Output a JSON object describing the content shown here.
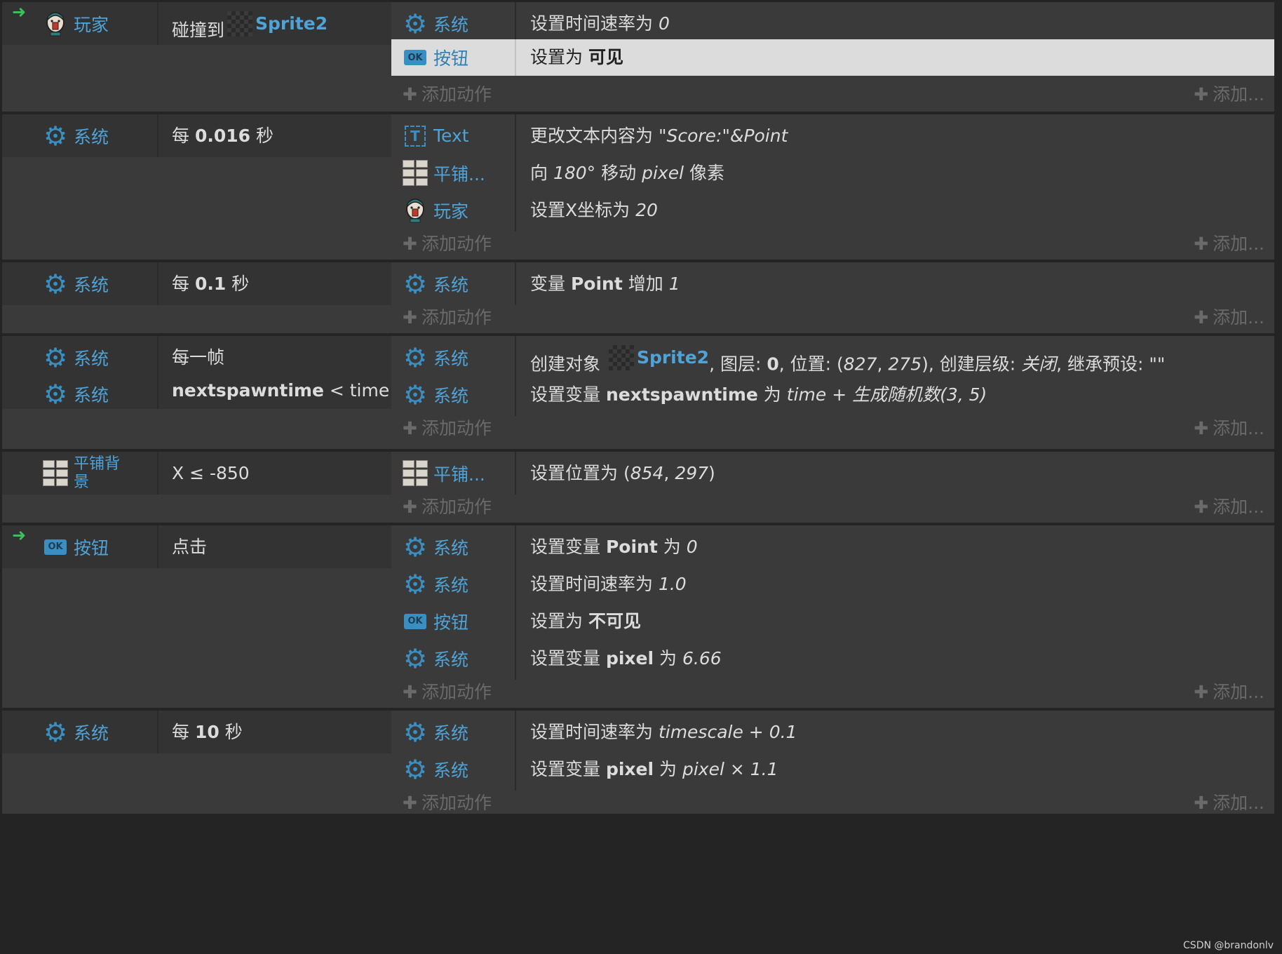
{
  "blocks": [
    {
      "conditions": [
        {
          "trigger": true,
          "icon": "player-icon",
          "object": "玩家",
          "text_prefix": "碰撞到",
          "text_object": "Sprite2"
        }
      ],
      "actions": [
        {
          "icon": "gear-icon",
          "object": "系统",
          "text": "设置时间速率为 ",
          "text_italic": "0"
        },
        {
          "icon": "ok-button-icon",
          "object": "按钮",
          "selected": true,
          "text": "设置为 ",
          "text_bold": "可见"
        }
      ]
    },
    {
      "conditions": [
        {
          "icon": "gear-icon",
          "object": "系统",
          "text": "每 ",
          "text_bold": "0.016",
          "text_after": " 秒"
        }
      ],
      "actions": [
        {
          "icon": "text-object-icon",
          "object": "Text",
          "text": "更改文本内容为 ",
          "text_italic": "\"Score:\"&Point"
        },
        {
          "icon": "tiled-background-icon",
          "object": "平铺...",
          "text": "向 ",
          "text_italic": "180°",
          "text_after": " 移动 ",
          "text_italic2": "pixel",
          "text_after2": " 像素"
        },
        {
          "icon": "player-icon",
          "object": "玩家",
          "text": "设置X坐标为 ",
          "text_italic": "20"
        }
      ]
    },
    {
      "conditions": [
        {
          "icon": "gear-icon",
          "object": "系统",
          "text": "每 ",
          "text_bold": "0.1",
          "text_after": " 秒"
        }
      ],
      "actions": [
        {
          "icon": "gear-icon",
          "object": "系统",
          "text": "变量 ",
          "text_bold": "Point",
          "text_after": " 增加 ",
          "text_italic": "1"
        }
      ]
    },
    {
      "conditions": [
        {
          "icon": "gear-icon",
          "object": "系统",
          "text": "每一帧"
        },
        {
          "icon": "gear-icon",
          "object": "系统",
          "text_bold": "nextspawntime",
          "text_after": " < time"
        }
      ],
      "actions": [
        {
          "icon": "gear-icon",
          "object": "系统",
          "text": "创建对象 ",
          "text_object": "Sprite2",
          "text_after": ", 图层: ",
          "text_bold": "0",
          "text_after2": ", 位置: (",
          "text_italic": "827",
          "text_after3": ", ",
          "text_italic2": "275",
          "text_after4": "), 创建层级: ",
          "text_italic3": "关闭",
          "text_after5": ", 继承预设: \"\""
        },
        {
          "icon": "gear-icon",
          "object": "系统",
          "text": "设置变量 ",
          "text_bold": "nextspawntime",
          "text_after": " 为 ",
          "text_italic": "time + 生成随机数(3, 5)"
        }
      ]
    },
    {
      "conditions": [
        {
          "icon": "tiled-background-icon",
          "object": "平铺背景",
          "text": "X ≤ -850"
        }
      ],
      "actions": [
        {
          "icon": "tiled-background-icon",
          "object": "平铺...",
          "text": "设置位置为 (",
          "text_italic": "854",
          "text_after": ", ",
          "text_italic2": "297",
          "text_after2": ")"
        }
      ]
    },
    {
      "conditions": [
        {
          "trigger": true,
          "icon": "ok-button-icon",
          "object": "按钮",
          "text": "点击"
        }
      ],
      "actions": [
        {
          "icon": "gear-icon",
          "object": "系统",
          "text": "设置变量 ",
          "text_bold": "Point",
          "text_after": " 为 ",
          "text_italic": "0"
        },
        {
          "icon": "gear-icon",
          "object": "系统",
          "text": "设置时间速率为 ",
          "text_italic": "1.0"
        },
        {
          "icon": "ok-button-icon",
          "object": "按钮",
          "text": "设置为 ",
          "text_bold": "不可见"
        },
        {
          "icon": "gear-icon",
          "object": "系统",
          "text": "设置变量 ",
          "text_bold": "pixel",
          "text_after": " 为 ",
          "text_italic": "6.66"
        }
      ]
    },
    {
      "conditions": [
        {
          "icon": "gear-icon",
          "object": "系统",
          "text": "每 ",
          "text_bold": "10",
          "text_after": " 秒"
        }
      ],
      "actions": [
        {
          "icon": "gear-icon",
          "object": "系统",
          "text": "设置时间速率为 ",
          "text_italic": "timescale + 0.1"
        },
        {
          "icon": "gear-icon",
          "object": "系统",
          "text": "设置变量 ",
          "text_bold": "pixel",
          "text_after": " 为 ",
          "text_italic": "pixel × 1.1"
        }
      ]
    }
  ],
  "labels": {
    "add_action": "添加动作",
    "add_more": "添加...",
    "ok_badge": "OK",
    "text_badge": "T",
    "trigger_arrow": "➜",
    "watermark": "CSDN @brandonlv"
  },
  "colors": {
    "object_name": "#4fa3d6",
    "icon_blue": "#3a8fc2",
    "trigger_arrow": "#3fbf5a",
    "selected_row": "#dcdcdc"
  }
}
